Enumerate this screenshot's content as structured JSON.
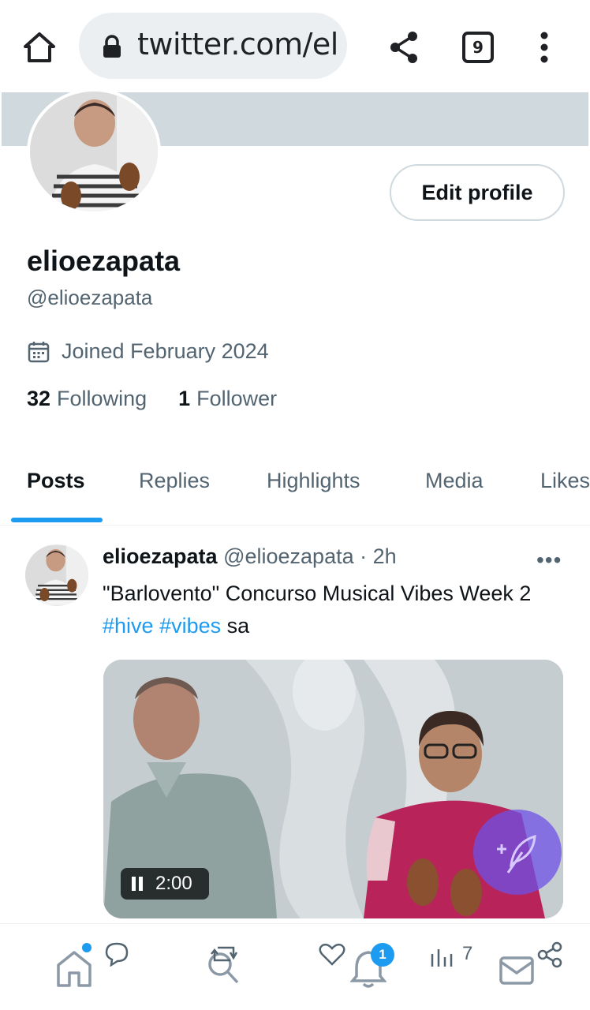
{
  "browser": {
    "url": "twitter.com/el",
    "tab_count": "9",
    "icons": [
      "home-icon",
      "lock-icon",
      "share-icon",
      "tabs-icon",
      "more-vertical-icon"
    ]
  },
  "profile": {
    "edit_button_label": "Edit profile",
    "display_name": "elioezapata",
    "handle": "@elioezapata",
    "joined": "Joined February 2024",
    "following_count": "32",
    "following_label": "Following",
    "followers_count": "1",
    "followers_label": "Follower"
  },
  "tabs": [
    {
      "label": "Posts",
      "active": true
    },
    {
      "label": "Replies",
      "active": false
    },
    {
      "label": "Highlights",
      "active": false
    },
    {
      "label": "Media",
      "active": false
    },
    {
      "label": "Likes",
      "active": false
    }
  ],
  "post": {
    "name": "elioezapata",
    "handle": "@elioezapata",
    "separator": "·",
    "time": "2h",
    "more": "•••",
    "text_prefix": "\"Barlovento\" Concurso Musical Vibes Week 2",
    "hashtag_1": "#hive",
    "hashtag_2": "#vibes",
    "text_suffix": "sa",
    "video_time": "2:00",
    "views": "7"
  },
  "bottom_nav": {
    "notification_count": "1"
  },
  "colors": {
    "accent": "#1d9bf0",
    "text_primary": "#0f1419",
    "text_secondary": "#536471",
    "banner": "#cfd9de"
  }
}
